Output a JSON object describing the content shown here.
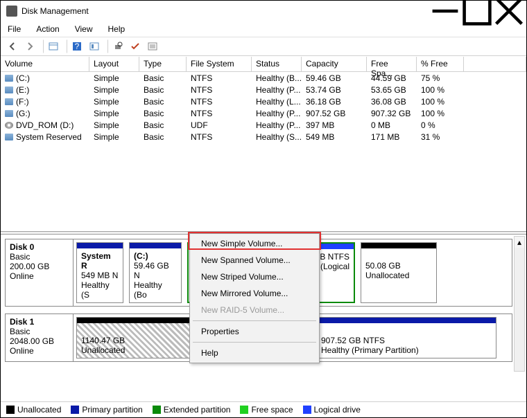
{
  "window": {
    "title": "Disk Management"
  },
  "menu": {
    "file": "File",
    "action": "Action",
    "view": "View",
    "help": "Help"
  },
  "columns": {
    "volume": "Volume",
    "layout": "Layout",
    "type": "Type",
    "fs": "File System",
    "status": "Status",
    "capacity": "Capacity",
    "free": "Free Spa...",
    "pct": "% Free"
  },
  "volumes": [
    {
      "icon": "disk",
      "name": "(C:)",
      "layout": "Simple",
      "type": "Basic",
      "fs": "NTFS",
      "status": "Healthy (B...",
      "capacity": "59.46 GB",
      "free": "44.59 GB",
      "pct": "75 %"
    },
    {
      "icon": "disk",
      "name": "(E:)",
      "layout": "Simple",
      "type": "Basic",
      "fs": "NTFS",
      "status": "Healthy (P...",
      "capacity": "53.74 GB",
      "free": "53.65 GB",
      "pct": "100 %"
    },
    {
      "icon": "disk",
      "name": "(F:)",
      "layout": "Simple",
      "type": "Basic",
      "fs": "NTFS",
      "status": "Healthy (L...",
      "capacity": "36.18 GB",
      "free": "36.08 GB",
      "pct": "100 %"
    },
    {
      "icon": "disk",
      "name": "(G:)",
      "layout": "Simple",
      "type": "Basic",
      "fs": "NTFS",
      "status": "Healthy (P...",
      "capacity": "907.52 GB",
      "free": "907.32 GB",
      "pct": "100 %"
    },
    {
      "icon": "dvd",
      "name": "DVD_ROM (D:)",
      "layout": "Simple",
      "type": "Basic",
      "fs": "UDF",
      "status": "Healthy (P...",
      "capacity": "397 MB",
      "free": "0 MB",
      "pct": "0 %"
    },
    {
      "icon": "disk",
      "name": "System Reserved",
      "layout": "Simple",
      "type": "Basic",
      "fs": "NTFS",
      "status": "Healthy (S...",
      "capacity": "549 MB",
      "free": "171 MB",
      "pct": "31 %"
    }
  ],
  "disks": {
    "d0": {
      "title": "Disk 0",
      "type": "Basic",
      "size": "200.00 GB",
      "state": "Online"
    },
    "d1": {
      "title": "Disk 1",
      "type": "Basic",
      "size": "2048.00 GB",
      "state": "Online"
    }
  },
  "parts0": {
    "p1": {
      "l1": "System R",
      "l2": "549 MB N",
      "l3": "Healthy (S"
    },
    "p2": {
      "l1": "(C:)",
      "l2": "59.46 GB N",
      "l3": "Healthy (Bo"
    },
    "p3": {
      "l2": "B NTFS",
      "l3": "y (Logical"
    },
    "p4": {
      "l2": "50.08 GB",
      "l3": "Unallocated"
    }
  },
  "parts1": {
    "p1": {
      "l2": "1140.47 GB",
      "l3": "Unallocated"
    },
    "p2": {
      "l2": "907.52 GB NTFS",
      "l3": "Healthy (Primary Partition)"
    }
  },
  "legend": {
    "unalloc": "Unallocated",
    "primary": "Primary partition",
    "extended": "Extended partition",
    "free": "Free space",
    "logical": "Logical drive"
  },
  "ctx": {
    "simple": "New Simple Volume...",
    "spanned": "New Spanned Volume...",
    "striped": "New Striped Volume...",
    "mirrored": "New Mirrored Volume...",
    "raid5": "New RAID-5 Volume...",
    "props": "Properties",
    "help": "Help"
  },
  "colors": {
    "unalloc": "#000000",
    "primary": "#0a1aa8",
    "extended": "#0a8a0a",
    "free": "#20d020",
    "logical": "#2040ff"
  }
}
